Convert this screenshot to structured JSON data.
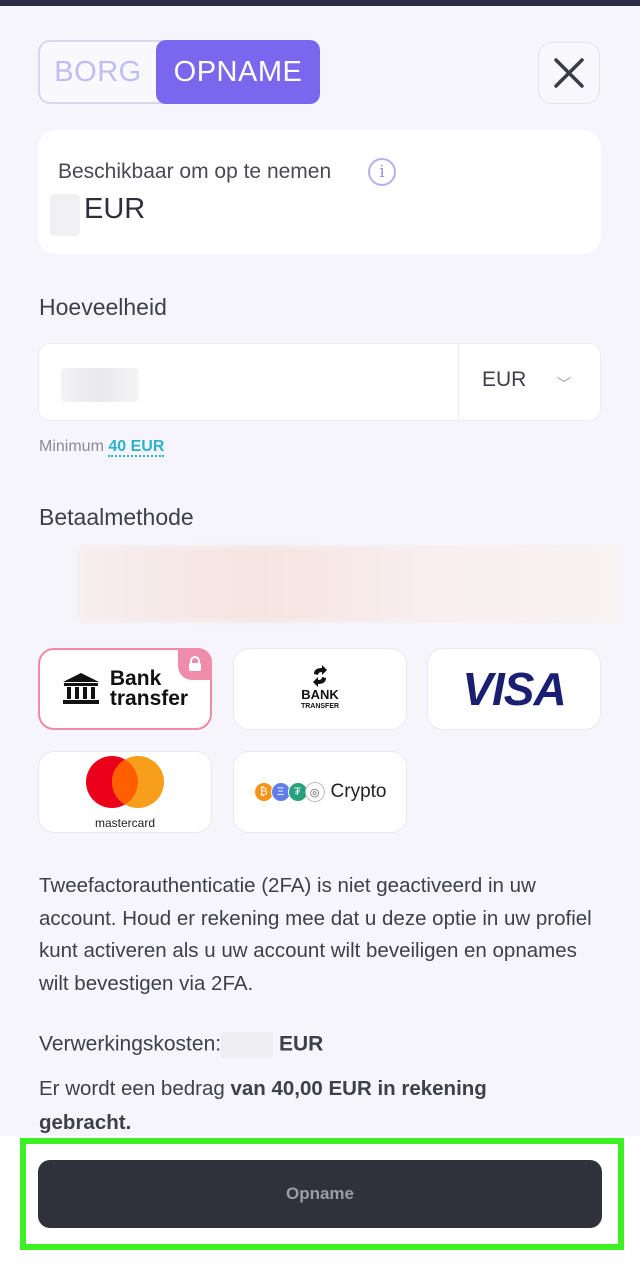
{
  "tabs": {
    "borg": "BORG",
    "opname": "OPNAME"
  },
  "balance": {
    "label": "Beschikbaar om op te nemen",
    "currency": "EUR"
  },
  "amount": {
    "label": "Hoeveelheid",
    "currency": "EUR",
    "minimum_label": "Minimum",
    "minimum_value": "40 EUR"
  },
  "payment": {
    "label": "Betaalmethode",
    "methods": [
      {
        "name": "Bank transfer",
        "line1": "Bank",
        "line2": "transfer",
        "selected": true,
        "locked": true
      },
      {
        "name": "BANK TRANSFER",
        "line1": "BANK",
        "line2": "TRANSFER"
      },
      {
        "name": "VISA"
      },
      {
        "name": "mastercard"
      },
      {
        "name": "Crypto",
        "coins": [
          "₿",
          "Ξ",
          "₮",
          "◎"
        ]
      }
    ]
  },
  "notice": "Tweefactorauthenticatie (2FA) is niet geactiveerd in uw account. Houd er rekening mee dat u deze optie in uw profiel kunt activeren als u uw account wilt beveiligen en opnames wilt bevestigen via 2FA.",
  "fee": {
    "label": "Verwerkingskosten:",
    "currency": "EUR"
  },
  "charge": {
    "prefix": "Er wordt een bedrag",
    "bold": "van 40,00 EUR in rekening gebracht."
  },
  "submit_label": "Opname",
  "colors": {
    "accent": "#7a67ee",
    "highlight": "#3cf023",
    "button": "#2f323b",
    "selected_border": "#ef8aa8"
  }
}
